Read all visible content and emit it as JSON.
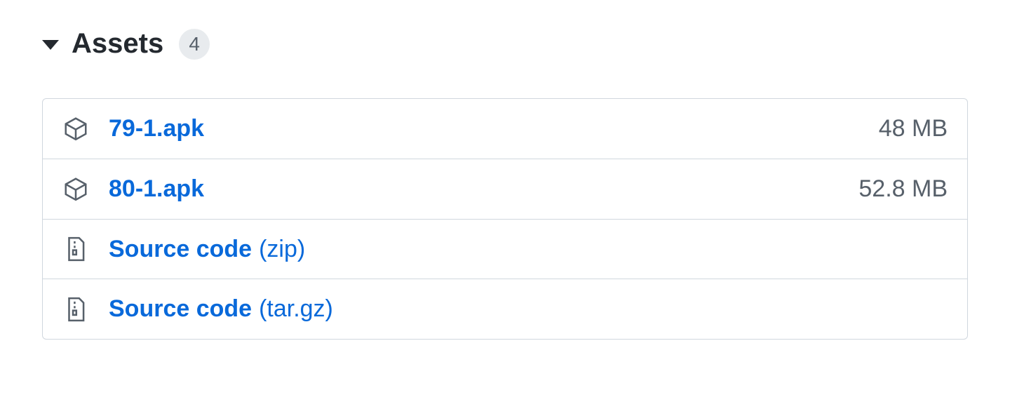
{
  "assets": {
    "title": "Assets",
    "count": "4",
    "items": [
      {
        "icon": "package",
        "name": "79-1.apk",
        "ext": "",
        "size": "48 MB"
      },
      {
        "icon": "package",
        "name": "80-1.apk",
        "ext": "",
        "size": "52.8 MB"
      },
      {
        "icon": "zip",
        "name": "Source code",
        "ext": "(zip)",
        "size": ""
      },
      {
        "icon": "zip",
        "name": "Source code",
        "ext": "(tar.gz)",
        "size": ""
      }
    ]
  },
  "colors": {
    "link": "#0969da",
    "muted": "#57606a",
    "border": "#d0d7de",
    "text": "#24292f",
    "badgeBg": "#e8ebee"
  }
}
